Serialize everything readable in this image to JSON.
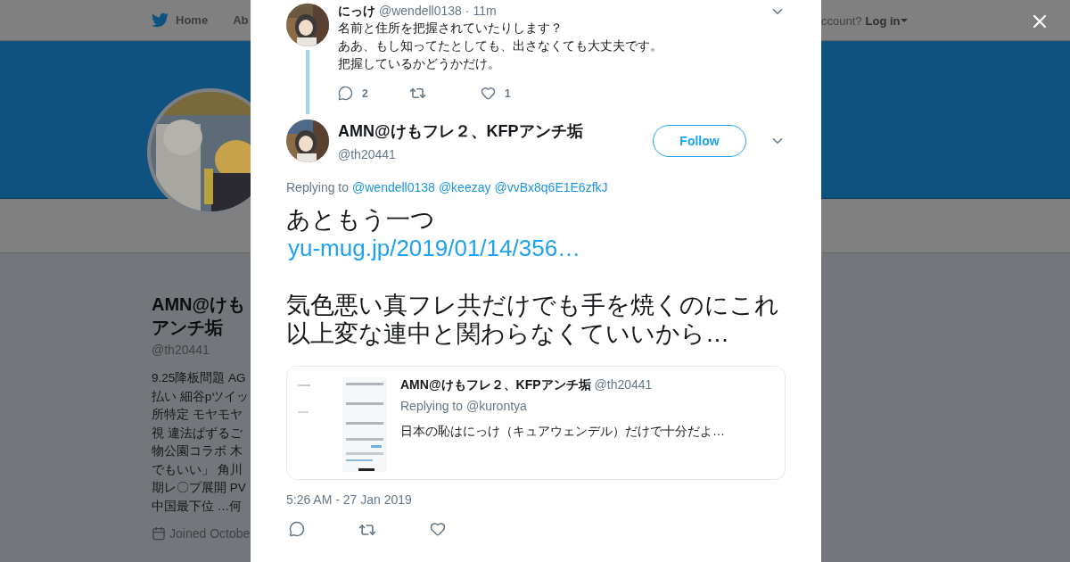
{
  "nav": {
    "items": [
      "Home",
      "Ab"
    ],
    "login_prompt": "ccount?",
    "login": "Log in"
  },
  "profile": {
    "name_lines": [
      "AMN@けも",
      "アンチ垢"
    ],
    "handle": "@th20441",
    "bio_lines": [
      "9.25降板問題 AG",
      "払い 細谷pツイッ",
      "所特定 モヤモヤ",
      "視 違法ぱずるご",
      "物公園コラボ 木",
      "でもいい」 角川",
      "期レ〇プ展開 PV",
      "中国最下位 …何"
    ],
    "joined": "Joined Octobe"
  },
  "parent_tweet": {
    "name": "にっけ",
    "handle": "@wendell0138",
    "time": "· 11m",
    "lines": [
      "名前と住所を把握されていたりします？",
      "ああ、もし知ってたとしても、出さなくても大丈夫です。",
      "把握しているかどうかだけ。"
    ],
    "replies": "2",
    "likes": "1"
  },
  "tweet": {
    "name": "AMN@けもフレ２、KFPアンチ垢",
    "handle": "@th20441",
    "follow": "Follow",
    "replying_label": "Replying to",
    "mentions": [
      "@wendell0138",
      "@keezay",
      "@vvBx8q6E1E6zfkJ"
    ],
    "body": [
      {
        "kind": "text",
        "text": "あともう一つ"
      },
      {
        "kind": "link",
        "text": "yu-mug.jp/2019/01/14/356…"
      },
      {
        "kind": "paragraph",
        "text": "気色悪い真フレ共だけでも手を焼くのにこれ以上変な連中と関わらなくていいから…"
      }
    ],
    "quote": {
      "name": "AMN@けもフレ２、KFPアンチ垢",
      "handle": "@th20441",
      "replying_label": "Replying to",
      "mention": "@kurontya",
      "text": "日本の恥はにっけ（キュアウェンデル）だけで十分だよ…"
    },
    "timestamp": "5:26 AM - 27 Jan 2019"
  }
}
